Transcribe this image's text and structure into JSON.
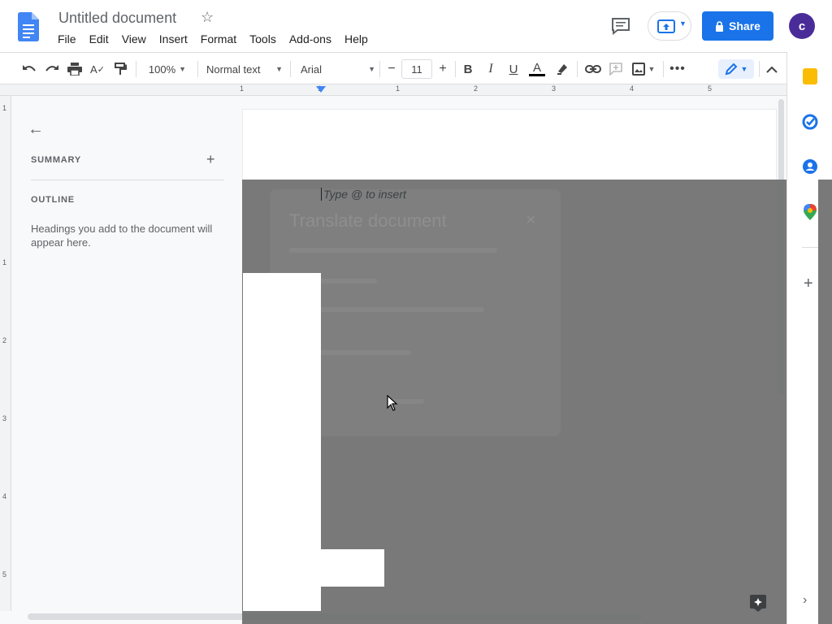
{
  "header": {
    "title": "Untitled document",
    "menu": [
      "File",
      "Edit",
      "View",
      "Insert",
      "Format",
      "Tools",
      "Add-ons",
      "Help"
    ],
    "share_label": "Share",
    "avatar_letter": "c"
  },
  "toolbar": {
    "zoom": "100%",
    "style": "Normal text",
    "font": "Arial",
    "font_size": "11"
  },
  "ruler": {
    "h_numbers": [
      "1",
      "1",
      "1",
      "2",
      "3",
      "4",
      "5"
    ],
    "v_numbers": [
      "1",
      "1",
      "2",
      "3",
      "4",
      "5"
    ]
  },
  "outline": {
    "summary_label": "SUMMARY",
    "outline_label": "OUTLINE",
    "hint": "Headings you add to the document will appear here."
  },
  "document": {
    "placeholder": "Type @ to insert"
  },
  "dialog_ghost": {
    "title": "Translate document"
  },
  "colors": {
    "accent": "#1a73e8",
    "avatar": "#4a2c99",
    "overlay": "#6e6e6e"
  }
}
